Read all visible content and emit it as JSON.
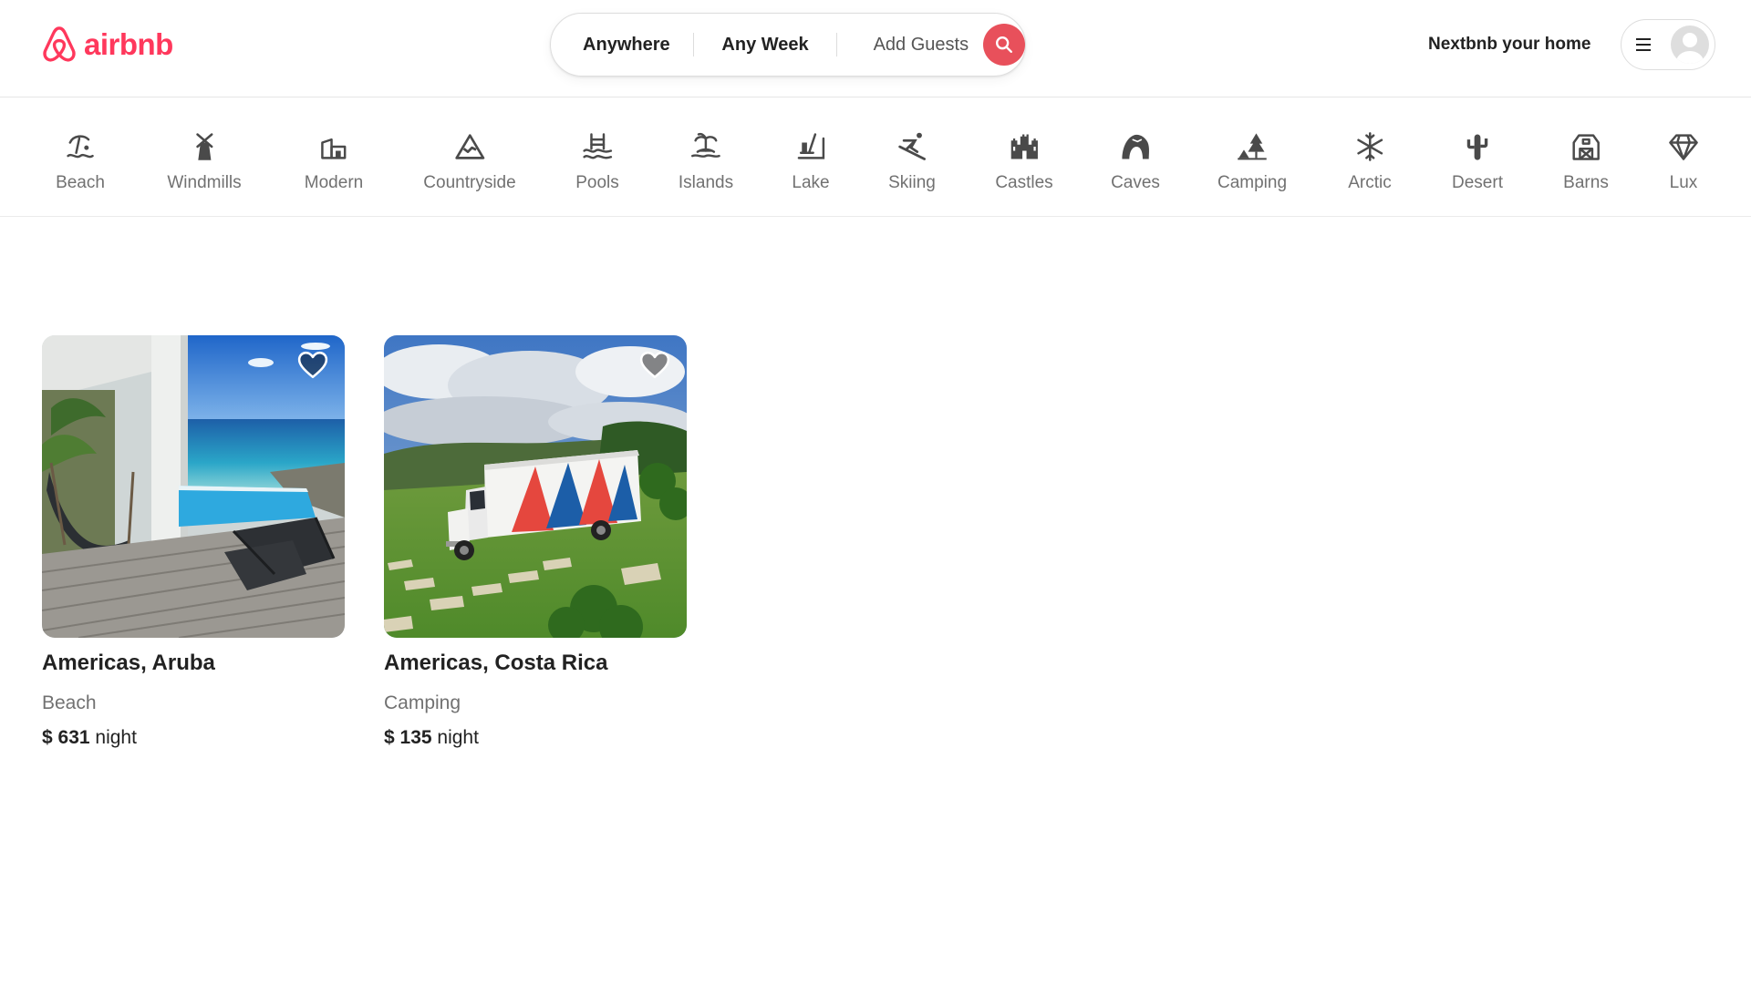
{
  "brand": {
    "name": "airbnb",
    "color": "#ff385c",
    "icon": "airbnb-logo-icon"
  },
  "search": {
    "where_label": "Anywhere",
    "week_label": "Any Week",
    "guests_label": "Add Guests",
    "button_color": "#e8505b",
    "button_icon": "search-icon"
  },
  "header": {
    "host_link": "Nextbnb your home",
    "menu_icon": "hamburger-icon",
    "avatar_icon": "avatar-icon"
  },
  "categories": [
    {
      "label": "Beach",
      "icon": "beach-icon"
    },
    {
      "label": "Windmills",
      "icon": "windmill-icon"
    },
    {
      "label": "Modern",
      "icon": "modern-house-icon"
    },
    {
      "label": "Countryside",
      "icon": "mountain-icon"
    },
    {
      "label": "Pools",
      "icon": "pool-icon"
    },
    {
      "label": "Islands",
      "icon": "island-icon"
    },
    {
      "label": "Lake",
      "icon": "lake-icon"
    },
    {
      "label": "Skiing",
      "icon": "skiing-icon"
    },
    {
      "label": "Castles",
      "icon": "castle-icon"
    },
    {
      "label": "Caves",
      "icon": "cave-icon"
    },
    {
      "label": "Camping",
      "icon": "camping-icon"
    },
    {
      "label": "Arctic",
      "icon": "snowflake-icon"
    },
    {
      "label": "Desert",
      "icon": "cactus-icon"
    },
    {
      "label": "Barns",
      "icon": "barn-icon"
    },
    {
      "label": "Lux",
      "icon": "diamond-icon"
    }
  ],
  "listings": [
    {
      "title": "Americas, Aruba",
      "category": "Beach",
      "price": "$ 631",
      "price_unit": "night",
      "favorite_icon": "heart-icon",
      "photo": "beach-villa-pool-photo"
    },
    {
      "title": "Americas, Costa Rica",
      "category": "Camping",
      "price": "$ 135",
      "price_unit": "night",
      "favorite_icon": "heart-icon",
      "photo": "camper-bus-hillside-photo"
    }
  ]
}
